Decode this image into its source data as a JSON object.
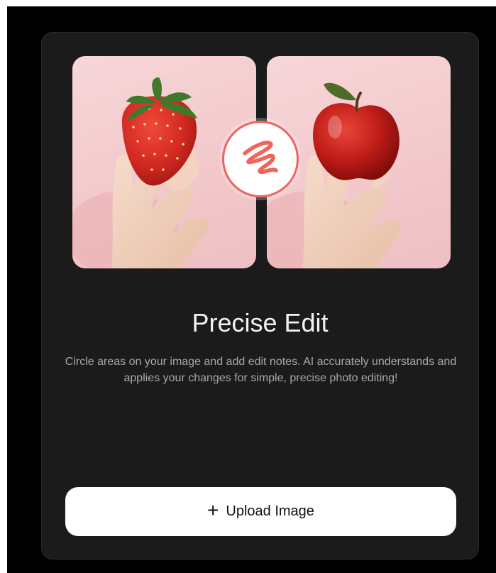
{
  "card": {
    "title": "Precise Edit",
    "description": "Circle areas on your image and add edit notes. AI accurately understands and applies your changes for simple, precise photo editing!",
    "upload_button": {
      "icon": "plus-icon",
      "icon_glyph": "+",
      "label": "Upload Image"
    },
    "images": {
      "before": "strawberry-in-hand-image",
      "after": "apple-in-hand-image"
    },
    "badge_icon": "scribble-edit-icon"
  },
  "colors": {
    "page_background": "#000000",
    "card_background": "#1b1b1b",
    "accent": "#f0655b",
    "title_text": "#f2f2f2",
    "description_text": "#a9a9a9",
    "button_background": "#ffffff"
  }
}
